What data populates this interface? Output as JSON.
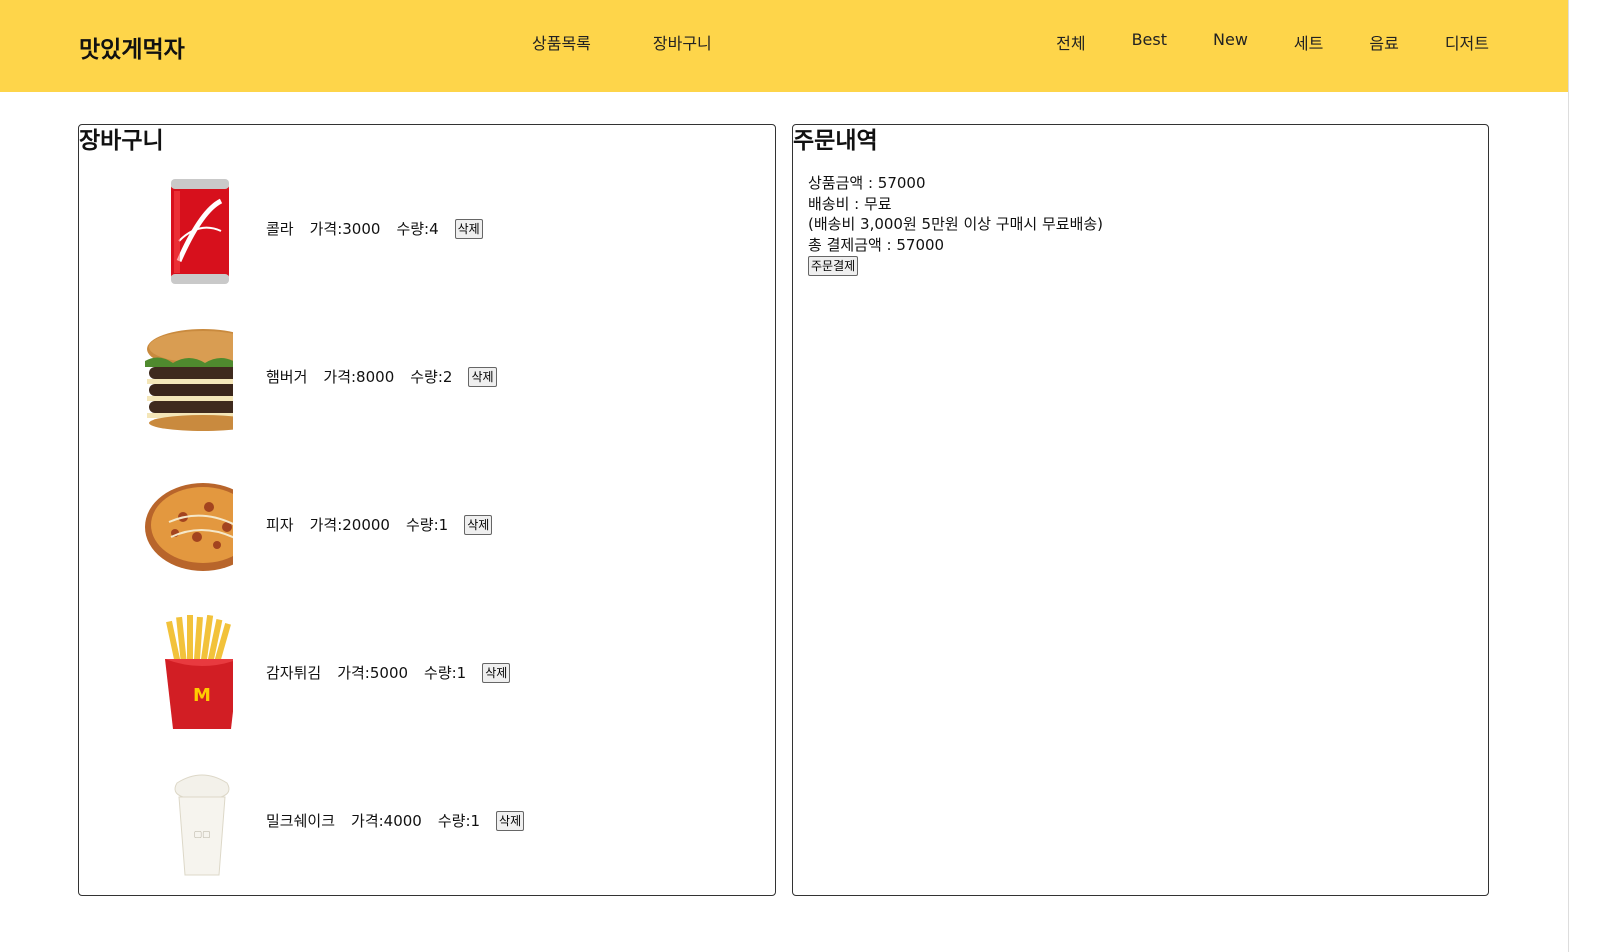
{
  "header": {
    "logo": "맛있게먹자",
    "main_nav": [
      "상품목록",
      "장바구니"
    ],
    "category_nav": [
      "전체",
      "Best",
      "New",
      "세트",
      "음료",
      "디저트"
    ],
    "accent_color": "#fed54a"
  },
  "cart": {
    "title": "장바구니",
    "items": [
      {
        "name": "콜라",
        "price": "가격:3000",
        "qty": "수량:4",
        "delete": "삭제",
        "icon": "cola-can-image"
      },
      {
        "name": "햄버거",
        "price": "가격:8000",
        "qty": "수량:2",
        "delete": "삭제",
        "icon": "hamburger-image"
      },
      {
        "name": "피자",
        "price": "가격:20000",
        "qty": "수량:1",
        "delete": "삭제",
        "icon": "pizza-image"
      },
      {
        "name": "감자튀김",
        "price": "가격:5000",
        "qty": "수량:1",
        "delete": "삭제",
        "icon": "french-fries-image"
      },
      {
        "name": "밀크쉐이크",
        "price": "가격:4000",
        "qty": "수량:1",
        "delete": "삭제",
        "icon": "milkshake-image"
      }
    ]
  },
  "order": {
    "title": "주문내역",
    "subtotal": "상품금액 : 57000",
    "shipping": "배송비 : 무료",
    "shipping_note": "(배송비 3,000원 5만원 이상 구매시 무료배송)",
    "total": "총 결제금액 : 57000",
    "pay_button": "주문결제"
  }
}
